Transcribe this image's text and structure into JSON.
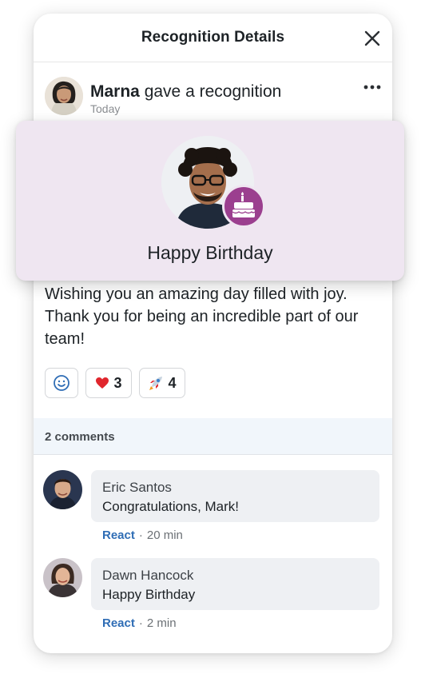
{
  "header": {
    "title": "Recognition Details",
    "close_icon": "close-icon"
  },
  "post": {
    "author": "Marna",
    "action": "gave a recognition",
    "time": "Today",
    "more_icon": "more-horizontal-icon",
    "message": "Wishing you an amazing day filled with joy. Thank you for being an incredible part of our team!"
  },
  "recognition": {
    "title": "Happy Birthday",
    "badge_icon": "birthday-cake-icon",
    "badge_color": "#9b3f8f",
    "card_color": "#efe6f1"
  },
  "reactions": [
    {
      "icon": "smiley-add-icon",
      "count": ""
    },
    {
      "icon": "heart-emoji",
      "emoji": "❤️",
      "count": "3"
    },
    {
      "icon": "rocket-emoji",
      "emoji": "🚀",
      "count": "4"
    }
  ],
  "comments_bar": {
    "label": "2 comments"
  },
  "comments": [
    {
      "name": "Eric Santos",
      "text": "Congratulations, Mark!",
      "react_label": "React",
      "time": "20 min"
    },
    {
      "name": "Dawn Hancock",
      "text": "Happy Birthday",
      "react_label": "React",
      "time": "2 min"
    }
  ],
  "colors": {
    "link": "#2f6db5",
    "comments_bar_bg": "#f1f6fb"
  }
}
